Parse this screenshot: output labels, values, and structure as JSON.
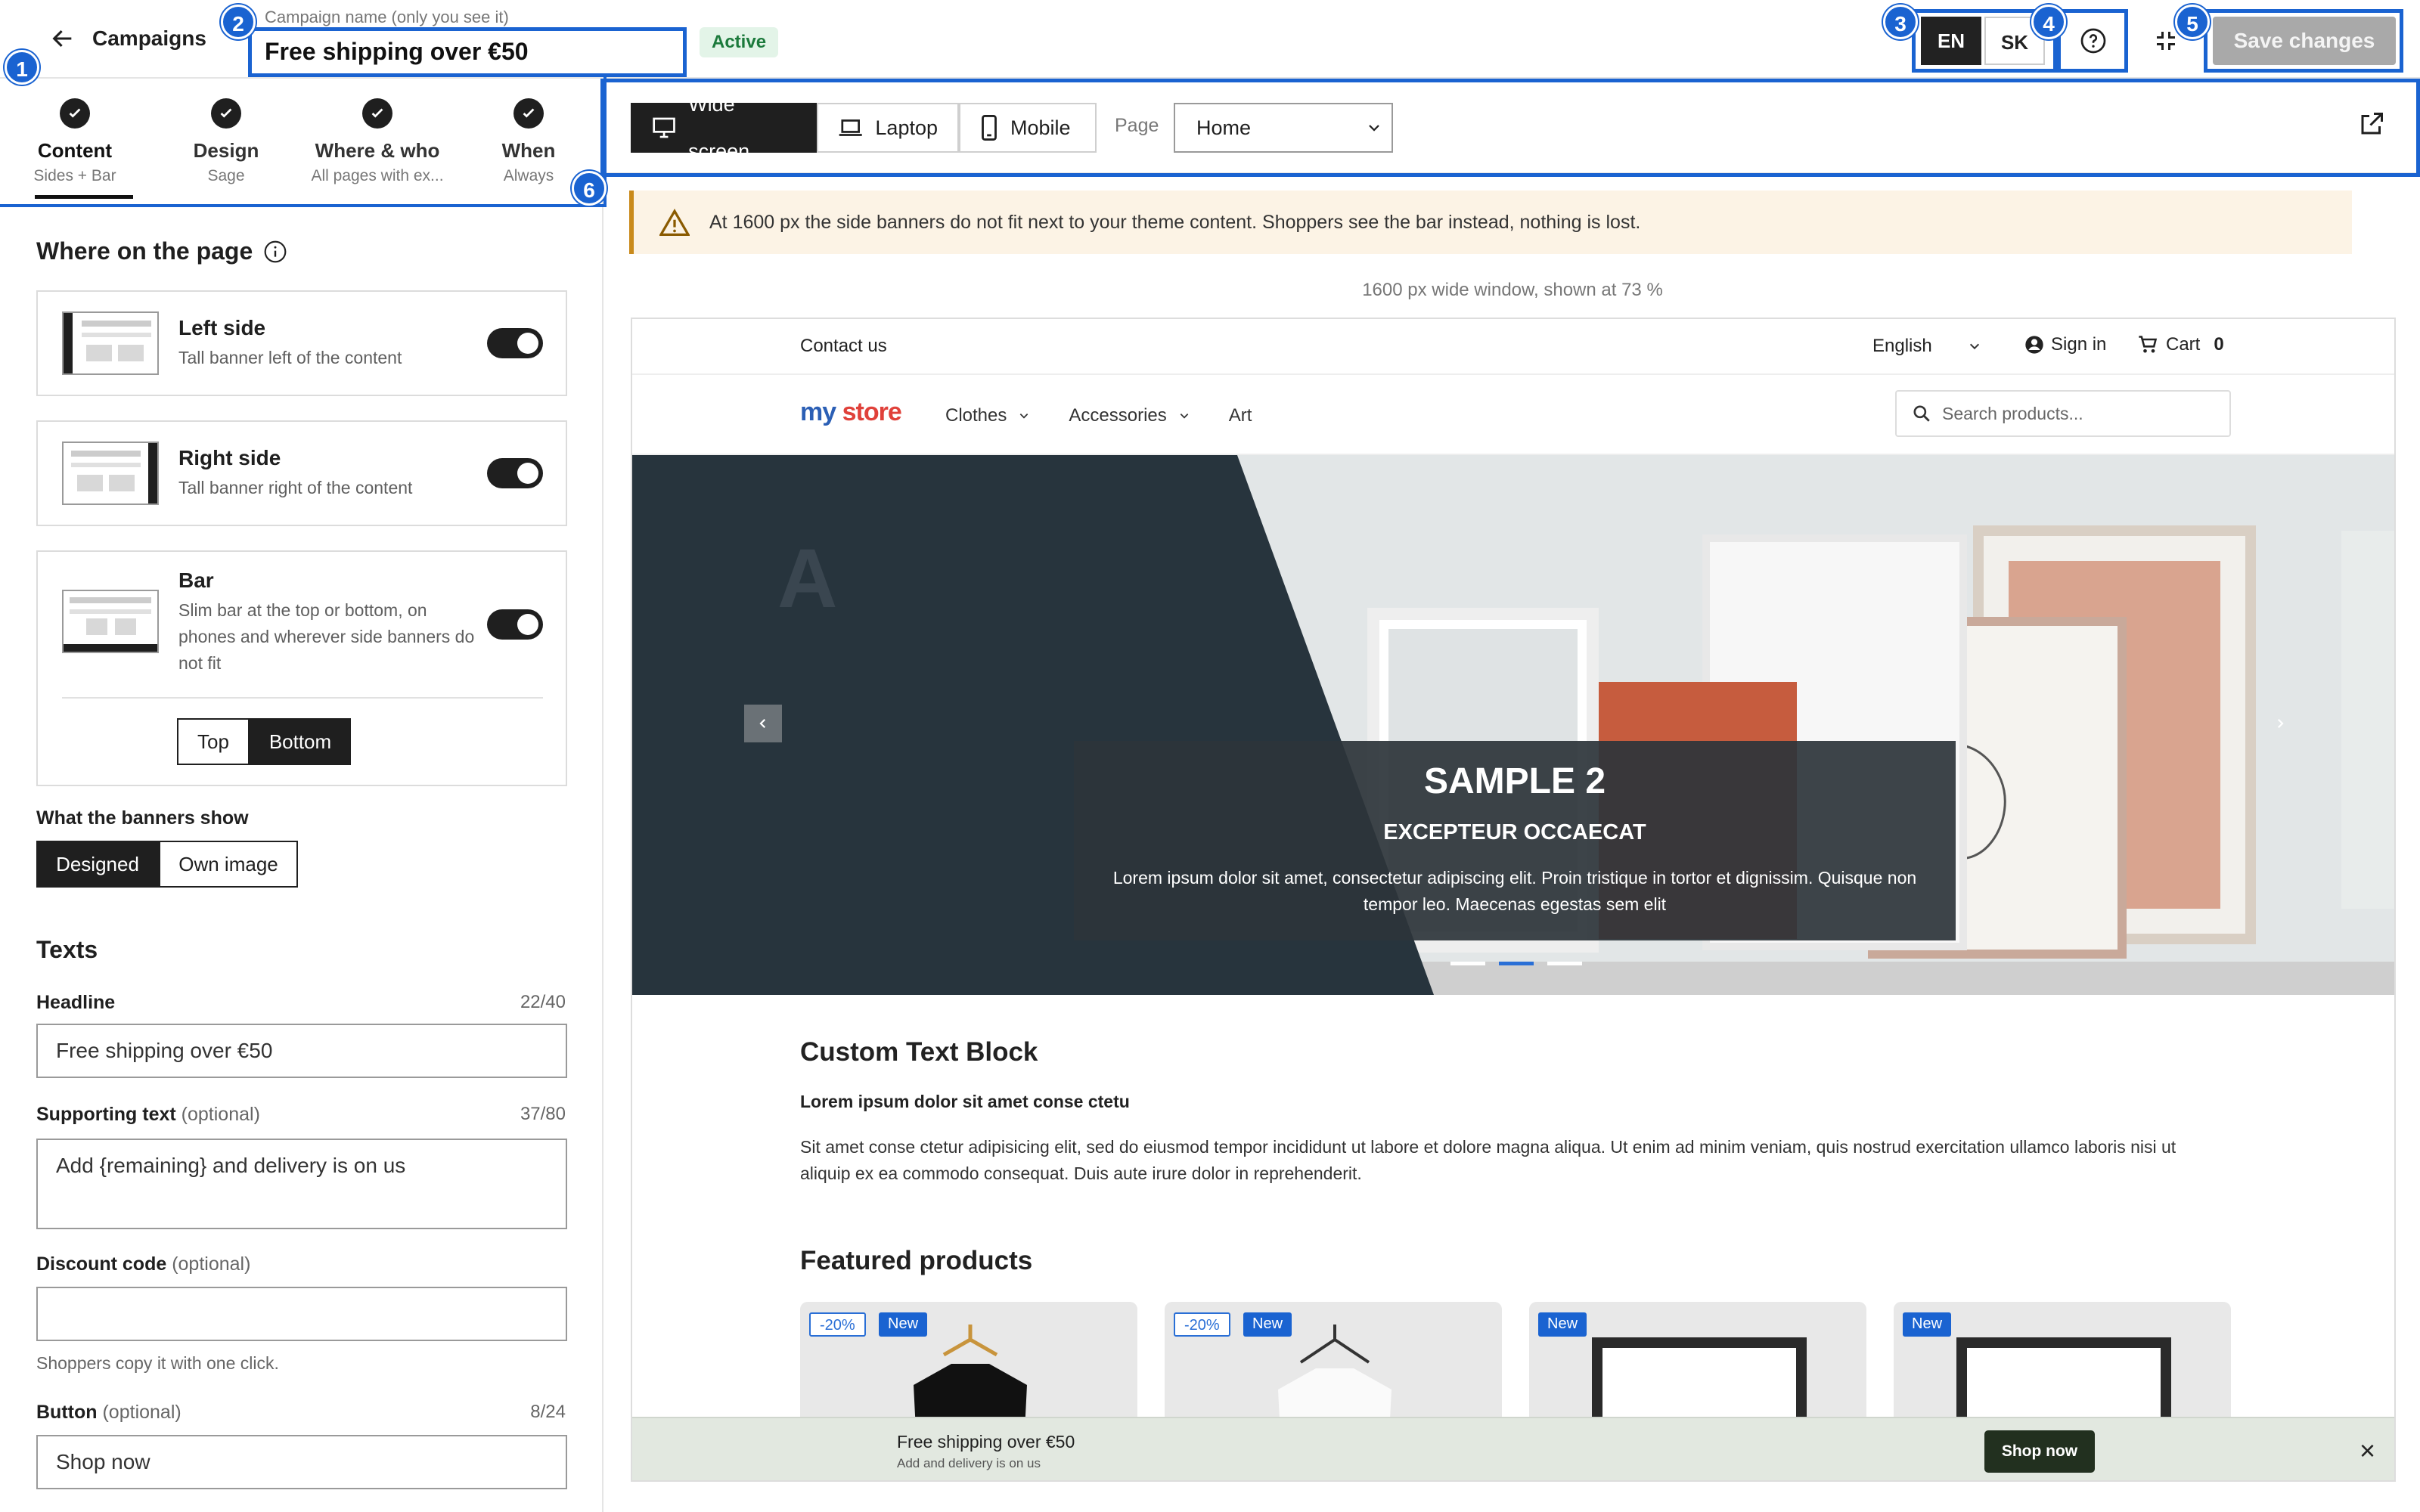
{
  "header": {
    "back_label": "Campaigns",
    "campaign_name_label": "Campaign name (only you see it)",
    "campaign_name": "Free shipping over €50",
    "status": "Active",
    "languages": [
      "EN",
      "SK"
    ],
    "save_label": "Save changes"
  },
  "markers": [
    "1",
    "2",
    "3",
    "4",
    "5",
    "6"
  ],
  "steps": [
    {
      "label": "Content",
      "sub": "Sides + Bar"
    },
    {
      "label": "Design",
      "sub": "Sage"
    },
    {
      "label": "Where & who",
      "sub": "All pages with ex..."
    },
    {
      "label": "When",
      "sub": "Always"
    }
  ],
  "placement": {
    "title": "Where on the page",
    "options": [
      {
        "title": "Left side",
        "desc": "Tall banner left of the content",
        "enabled": true
      },
      {
        "title": "Right side",
        "desc": "Tall banner right of the content",
        "enabled": true
      },
      {
        "title": "Bar",
        "desc": "Slim bar at the top or bottom, on phones and wherever side banners do not fit",
        "enabled": true
      }
    ],
    "bar_position": {
      "options": [
        "Top",
        "Bottom"
      ],
      "selected": "Bottom"
    }
  },
  "banner_show": {
    "label": "What the banners show",
    "options": [
      "Designed",
      "Own image"
    ],
    "selected": "Designed"
  },
  "texts": {
    "title": "Texts",
    "headline": {
      "label": "Headline",
      "count": "22/40",
      "value": "Free shipping over €50"
    },
    "supporting": {
      "label": "Supporting text",
      "optional": "(optional)",
      "count": "37/80",
      "value": "Add {remaining} and delivery is on us"
    },
    "discount": {
      "label": "Discount code",
      "optional": "(optional)",
      "value": "",
      "help": "Shoppers copy it with one click."
    },
    "button": {
      "label": "Button",
      "optional": "(optional)",
      "count": "8/24",
      "value": "Shop now"
    }
  },
  "toolbar": {
    "devices": [
      "Wide screen",
      "Laptop",
      "Mobile"
    ],
    "selected_device": "Wide screen",
    "page_label": "Page",
    "page_value": "Home"
  },
  "warning": "At 1600 px the side banners do not fit next to your theme content. Shoppers see the bar instead, nothing is lost.",
  "preview_note": "1600 px wide window, shown at 73 %",
  "store": {
    "contact": "Contact us",
    "language": "English",
    "sign_in": "Sign in",
    "cart_label": "Cart",
    "cart_count": "0",
    "logo_a": "my",
    "logo_b": "store",
    "nav": [
      "Clothes",
      "Accessories",
      "Art"
    ],
    "search_placeholder": "Search products...",
    "hero": {
      "logo_mark": "A",
      "title": "SAMPLE 2",
      "subtitle": "EXCEPTEUR OCCAECAT",
      "text": "Lorem ipsum dolor sit amet, consectetur adipiscing elit. Proin tristique in tortor et dignissim. Quisque non tempor leo. Maecenas egestas sem elit"
    },
    "custom_block": {
      "title": "Custom Text Block",
      "lead": "Lorem ipsum dolor sit amet conse ctetu",
      "body": "Sit amet conse ctetur adipisicing elit, sed do eiusmod tempor incididunt ut labore et dolore magna aliqua. Ut enim ad minim veniam, quis nostrud exercitation ullamco laboris nisi ut aliquip ex ea commodo consequat. Duis aute irure dolor in reprehenderit."
    },
    "featured_title": "Featured products",
    "products": [
      {
        "discount": "-20%",
        "badge": "New"
      },
      {
        "discount": "-20%",
        "badge": "New"
      },
      {
        "discount": "",
        "badge": "New"
      },
      {
        "discount": "",
        "badge": "New"
      }
    ],
    "bar": {
      "headline": "Free shipping over €50",
      "text": "Add and delivery is on us",
      "button": "Shop now",
      "close": "×"
    }
  }
}
